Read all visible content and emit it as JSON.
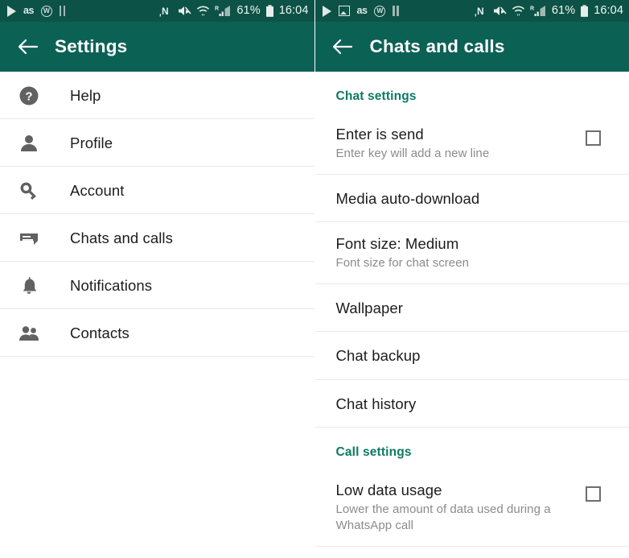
{
  "statusbar": {
    "left_screen": {
      "icons": [
        "play-icon",
        "lastfm-icon",
        "w-badge-icon",
        "pause-icon"
      ],
      "lastfm_label": "as",
      "w_label": "W",
      "nfc_label": "N",
      "roaming_label": "R",
      "battery_percent": "61%",
      "time": "16:04"
    },
    "right_screen": {
      "icons": [
        "play-icon",
        "image-icon",
        "lastfm-icon",
        "w-badge-icon",
        "pause-icon"
      ],
      "lastfm_label": "as",
      "w_label": "W",
      "nfc_label": "N",
      "roaming_label": "R",
      "battery_percent": "61%",
      "time": "16:04"
    }
  },
  "left_screen": {
    "toolbar": {
      "back_icon": "back-arrow-icon",
      "title": "Settings"
    },
    "items": [
      {
        "label": "Help",
        "icon": "help-circle-icon"
      },
      {
        "label": "Profile",
        "icon": "person-icon"
      },
      {
        "label": "Account",
        "icon": "key-icon"
      },
      {
        "label": "Chats and calls",
        "icon": "chat-bubble-icon"
      },
      {
        "label": "Notifications",
        "icon": "bell-icon"
      },
      {
        "label": "Contacts",
        "icon": "people-icon"
      }
    ]
  },
  "right_screen": {
    "toolbar": {
      "back_icon": "back-arrow-icon",
      "title": "Chats and calls"
    },
    "sections": [
      {
        "header": "Chat settings",
        "rows": [
          {
            "title": "Enter is send",
            "subtitle": "Enter key will add a new line",
            "checkbox": true,
            "checked": false
          },
          {
            "title": "Media auto-download",
            "subtitle": "",
            "checkbox": false,
            "checked": false
          },
          {
            "title": "Font size: Medium",
            "subtitle": "Font size for chat screen",
            "checkbox": false,
            "checked": false
          },
          {
            "title": "Wallpaper",
            "subtitle": "",
            "checkbox": false,
            "checked": false
          },
          {
            "title": "Chat backup",
            "subtitle": "",
            "checkbox": false,
            "checked": false
          },
          {
            "title": "Chat history",
            "subtitle": "",
            "checkbox": false,
            "checked": false
          }
        ]
      },
      {
        "header": "Call settings",
        "rows": [
          {
            "title": "Low data usage",
            "subtitle": "Lower the amount of data used during a WhatsApp call",
            "checkbox": true,
            "checked": false
          }
        ]
      }
    ]
  },
  "colors": {
    "statusbar_bg": "#0d5246",
    "toolbar_bg": "#0c6155",
    "section_header": "#0c7a63",
    "primary_text": "#1c1c1c",
    "secondary_text": "#8b8b8b",
    "icon_gray": "#616161",
    "divider": "#e8e8e8"
  }
}
